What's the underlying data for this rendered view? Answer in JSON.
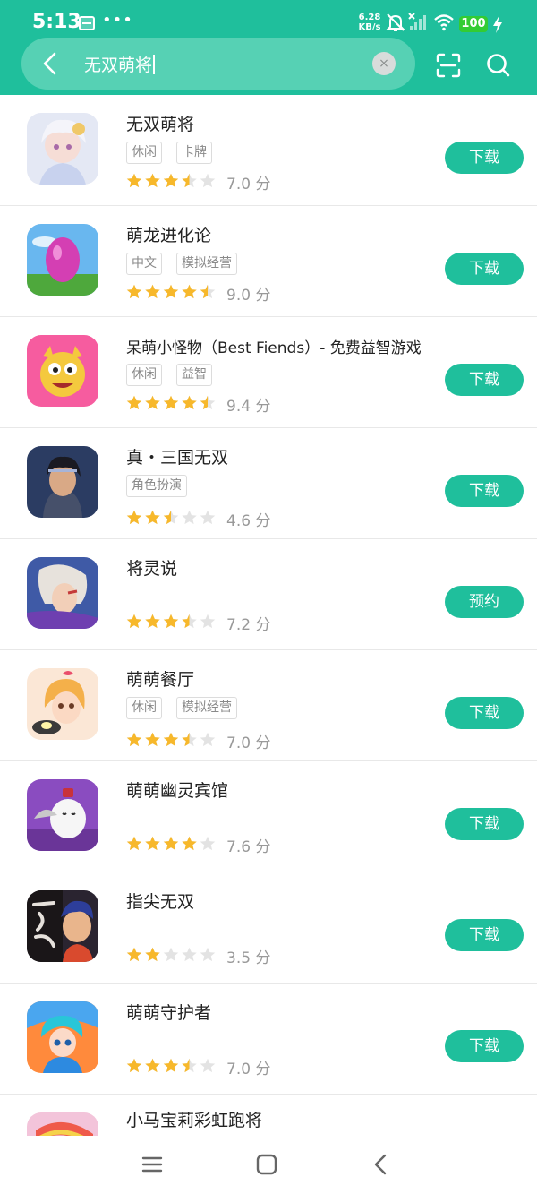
{
  "status": {
    "time": "5:13",
    "net_speed_value": "6.28",
    "net_speed_unit": "KB/s",
    "battery": "100",
    "icons": [
      "sim-icon",
      "more-dots-icon",
      "mute-icon",
      "signal-off-icon",
      "wifi-icon",
      "battery-icon",
      "charging-icon"
    ]
  },
  "search": {
    "query": "无双萌将",
    "clear_label": "×",
    "accent_color": "#1fbf9c"
  },
  "apps": [
    {
      "name": "无双萌将",
      "tags": [
        "休闲",
        "卡牌"
      ],
      "rating": 3.5,
      "score": "7.0 分",
      "button": "下载"
    },
    {
      "name": "萌龙进化论",
      "tags": [
        "中文",
        "模拟经营"
      ],
      "rating": 4.5,
      "score": "9.0 分",
      "button": "下载"
    },
    {
      "name": "呆萌小怪物（Best Fiends）- 免费益智游戏",
      "tags": [
        "休闲",
        "益智"
      ],
      "rating": 4.5,
      "score": "9.4 分",
      "button": "下载"
    },
    {
      "name": "真・三国无双",
      "tags": [
        "角色扮演"
      ],
      "rating": 2.5,
      "score": "4.6 分",
      "button": "下载"
    },
    {
      "name": "将灵说",
      "tags": [],
      "rating": 3.5,
      "score": "7.2 分",
      "button": "预约"
    },
    {
      "name": "萌萌餐厅",
      "tags": [
        "休闲",
        "模拟经营"
      ],
      "rating": 3.5,
      "score": "7.0 分",
      "button": "下载"
    },
    {
      "name": "萌萌幽灵宾馆",
      "tags": [],
      "rating": 4,
      "score": "7.6 分",
      "button": "下载"
    },
    {
      "name": "指尖无双",
      "tags": [],
      "rating": 2,
      "score": "3.5 分",
      "button": "下载"
    },
    {
      "name": "萌萌守护者",
      "tags": [],
      "rating": 3.5,
      "score": "7.0 分",
      "button": "下载"
    },
    {
      "name": "小马宝莉彩虹跑将",
      "tags": [],
      "rating": null,
      "score": "",
      "button": ""
    }
  ],
  "nav": {
    "icons": [
      "menu-icon",
      "home-icon",
      "back-icon"
    ]
  }
}
